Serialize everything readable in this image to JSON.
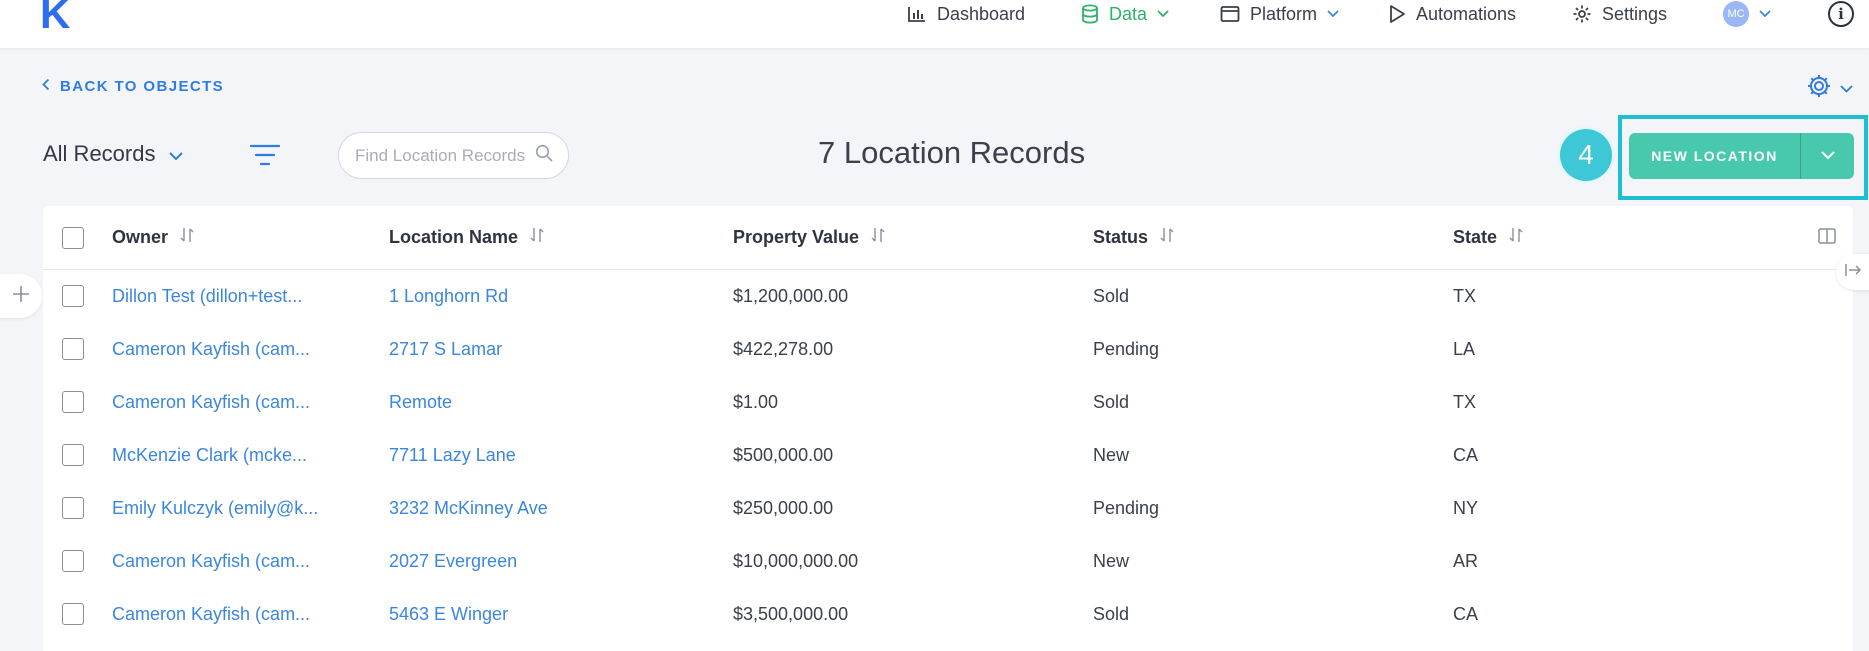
{
  "brand": {
    "logo_letter": "K",
    "color": "#2f6cf0"
  },
  "nav": {
    "dashboard": "Dashboard",
    "data": "Data",
    "platform": "Platform",
    "automations": "Automations",
    "settings": "Settings",
    "avatar_initials": "MC",
    "info": "i"
  },
  "back_link": "BACK TO OBJECTS",
  "records_view": "All Records",
  "search": {
    "placeholder": "Find Location Records"
  },
  "title": "7 Location Records",
  "step_badge": "4",
  "new_button": {
    "label": "NEW LOCATION",
    "color": "#48c9ad"
  },
  "table": {
    "columns": [
      "Owner",
      "Location Name",
      "Property Value",
      "Status",
      "State"
    ],
    "rows": [
      {
        "owner": "Dillon Test (dillon+test...",
        "location": "1 Longhorn Rd",
        "value": "$1,200,000.00",
        "status": "Sold",
        "state": "TX"
      },
      {
        "owner": "Cameron Kayfish (cam...",
        "location": "2717 S Lamar",
        "value": "$422,278.00",
        "status": "Pending",
        "state": "LA"
      },
      {
        "owner": "Cameron Kayfish (cam...",
        "location": "Remote",
        "value": "$1.00",
        "status": "Sold",
        "state": "TX"
      },
      {
        "owner": "McKenzie Clark (mcke...",
        "location": "7711 Lazy Lane",
        "value": "$500,000.00",
        "status": "New",
        "state": "CA"
      },
      {
        "owner": "Emily Kulczyk (emily@k...",
        "location": "3232 McKinney Ave",
        "value": "$250,000.00",
        "status": "Pending",
        "state": "NY"
      },
      {
        "owner": "Cameron Kayfish (cam...",
        "location": "2027 Evergreen",
        "value": "$10,000,000.00",
        "status": "New",
        "state": "AR"
      },
      {
        "owner": "Cameron Kayfish (cam...",
        "location": "5463 E Winger",
        "value": "$3,500,000.00",
        "status": "Sold",
        "state": "CA"
      }
    ]
  },
  "colors": {
    "link": "#3a86e0",
    "data_active": "#2db16b",
    "highlight": "#1ebfd0",
    "badge": "#3ec7d6"
  },
  "icons": [
    "chart-icon",
    "database-icon",
    "window-icon",
    "play-icon",
    "gear-icon",
    "info-icon",
    "filter-icon",
    "search-icon",
    "sort-icon",
    "columns-icon",
    "plus-icon",
    "collapse-icon"
  ]
}
